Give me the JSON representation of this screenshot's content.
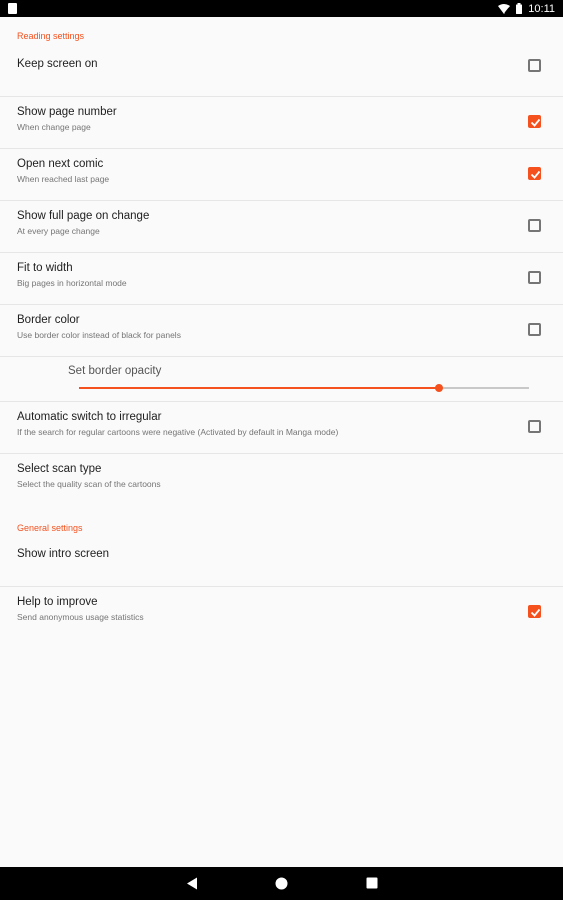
{
  "status_bar": {
    "time": "10:11",
    "icons": [
      "notification-icon",
      "wifi-icon",
      "battery-icon"
    ]
  },
  "reading_settings": {
    "header": "Reading settings",
    "items": [
      {
        "title": "Keep screen on",
        "summary": "",
        "checked": false
      },
      {
        "title": "Show page number",
        "summary": "When change page",
        "checked": true
      },
      {
        "title": "Open next comic",
        "summary": "When reached last page",
        "checked": true
      },
      {
        "title": "Show full page on change",
        "summary": "At every page change",
        "checked": false
      },
      {
        "title": "Fit to width",
        "summary": "Big pages in horizontal mode",
        "checked": false
      },
      {
        "title": "Border color",
        "summary": "Use border color instead of black for panels",
        "checked": false
      }
    ],
    "border_opacity": {
      "title": "Set border opacity",
      "value": 0.8
    },
    "auto_irregular": {
      "title": "Automatic switch to irregular",
      "summary": "If the search for regular cartoons were negative (Activated by default in Manga mode)",
      "checked": false
    },
    "scan_type": {
      "title": "Select scan type",
      "summary": "Select the quality scan of the cartoons"
    }
  },
  "general_settings": {
    "header": "General settings",
    "intro": {
      "title": "Show intro screen"
    },
    "help": {
      "title": "Help to improve",
      "summary": "Send anonymous usage statistics",
      "checked": true
    }
  },
  "nav_bar": {
    "icons": [
      "back-icon",
      "home-icon",
      "recents-icon"
    ]
  },
  "colors": {
    "accent": "#f4511e",
    "checkbox_unchecked": "#757575",
    "status_bar": "#000000",
    "background": "#fafafa"
  }
}
